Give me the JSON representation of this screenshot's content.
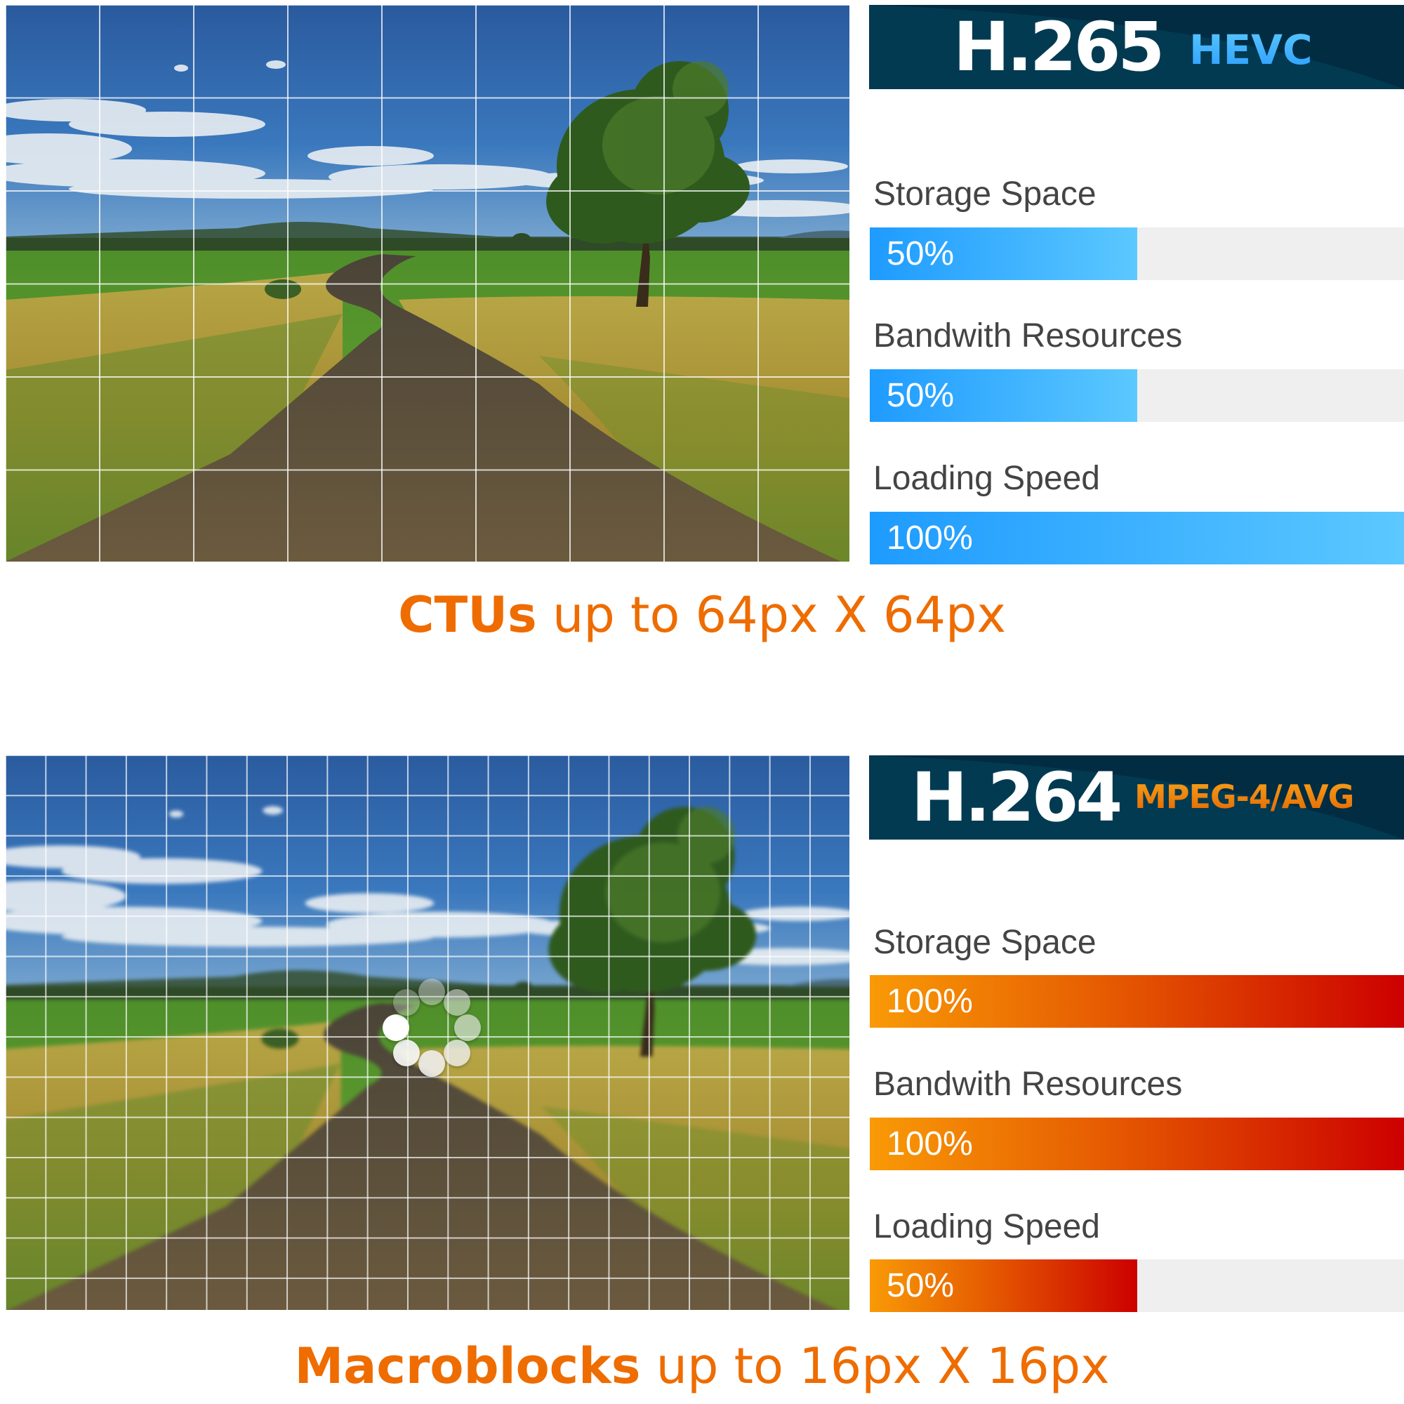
{
  "hevc_panel": {
    "codec_name": "H.265",
    "codec_subtitle": "HEVC",
    "accent_color": "#2a9dff",
    "metrics": [
      {
        "label": "Storage Space",
        "value_text": "50%",
        "fraction": 0.5
      },
      {
        "label": "Bandwith Resources",
        "value_text": "50%",
        "fraction": 0.5
      },
      {
        "label": "Loading Speed",
        "value_text": "100%",
        "fraction": 1.0
      }
    ],
    "caption_bold": "CTUs",
    "caption_rest": " up to 64px X 64px",
    "image_description": "Sharp photo of a winding country road through green fields with a lone tree, overlaid with a coarse white grid"
  },
  "avc_panel": {
    "codec_name": "H.264",
    "codec_subtitle": "MPEG-4/AVG",
    "accent_color": "#f07800",
    "metrics": [
      {
        "label": "Storage Space",
        "value_text": "100%",
        "fraction": 1.0
      },
      {
        "label": "Bandwith Resources",
        "value_text": "100%",
        "fraction": 1.0
      },
      {
        "label": "Loading Speed",
        "value_text": "50%",
        "fraction": 0.5
      }
    ],
    "caption_bold": "Macroblocks",
    "caption_rest": " up to 16px X 16px",
    "image_description": "Blurred version of the same road photo overlaid with a fine white grid and a loading spinner",
    "loading_icon": "loading-spinner-icon"
  },
  "colors": {
    "banner_bg": "#023a52",
    "caption_color": "#ee6c00",
    "label_color": "#444444",
    "track_color": "#efefef"
  }
}
